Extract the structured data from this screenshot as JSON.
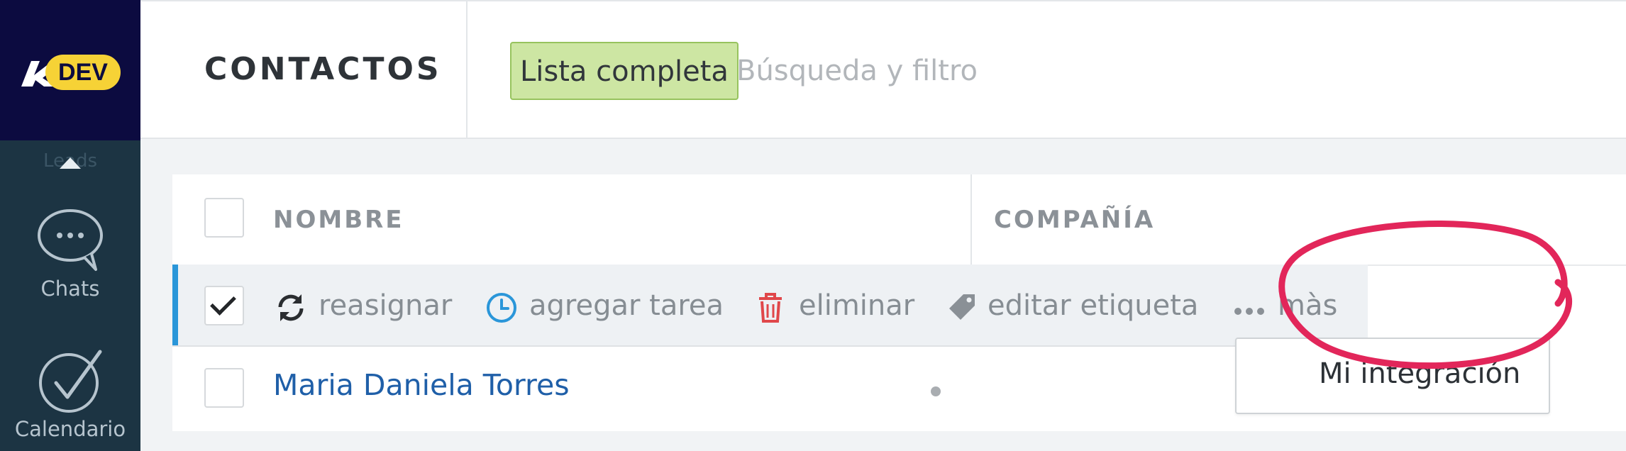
{
  "brand": {
    "logo_text": "DEV"
  },
  "nav": {
    "collapsed_label": "Leads",
    "items": [
      {
        "label": "Chats",
        "icon": "chat-bubble-icon"
      },
      {
        "label": "Calendario",
        "icon": "check-circle-icon"
      }
    ]
  },
  "header": {
    "title": "CONTACTOS",
    "list_chip": "Lista completa",
    "search_placeholder": "Búsqueda y filtro"
  },
  "table": {
    "columns": [
      "NOMBRE",
      "COMPAÑÍA"
    ],
    "actions": [
      {
        "label": "reasignar",
        "icon": "reassign-icon"
      },
      {
        "label": "agregar tarea",
        "icon": "clock-icon"
      },
      {
        "label": "eliminar",
        "icon": "trash-icon"
      },
      {
        "label": "editar etiqueta",
        "icon": "tag-icon"
      },
      {
        "label": "màs",
        "icon": "ellipsis-icon"
      }
    ],
    "rows": [
      {
        "name": "Maria Daniela Torres"
      }
    ]
  },
  "more_menu": {
    "items": [
      "Mi integración"
    ]
  },
  "colors": {
    "nav_bg": "#1c3443",
    "logo_bg": "#0c0b40",
    "logo_accent": "#f6d236",
    "chip_bg": "#cde6a3",
    "selected_accent": "#2a96d9",
    "link": "#1f5fa8",
    "delete": "#e0474a",
    "task": "#2a96d9",
    "annotation": "#e2265a"
  }
}
